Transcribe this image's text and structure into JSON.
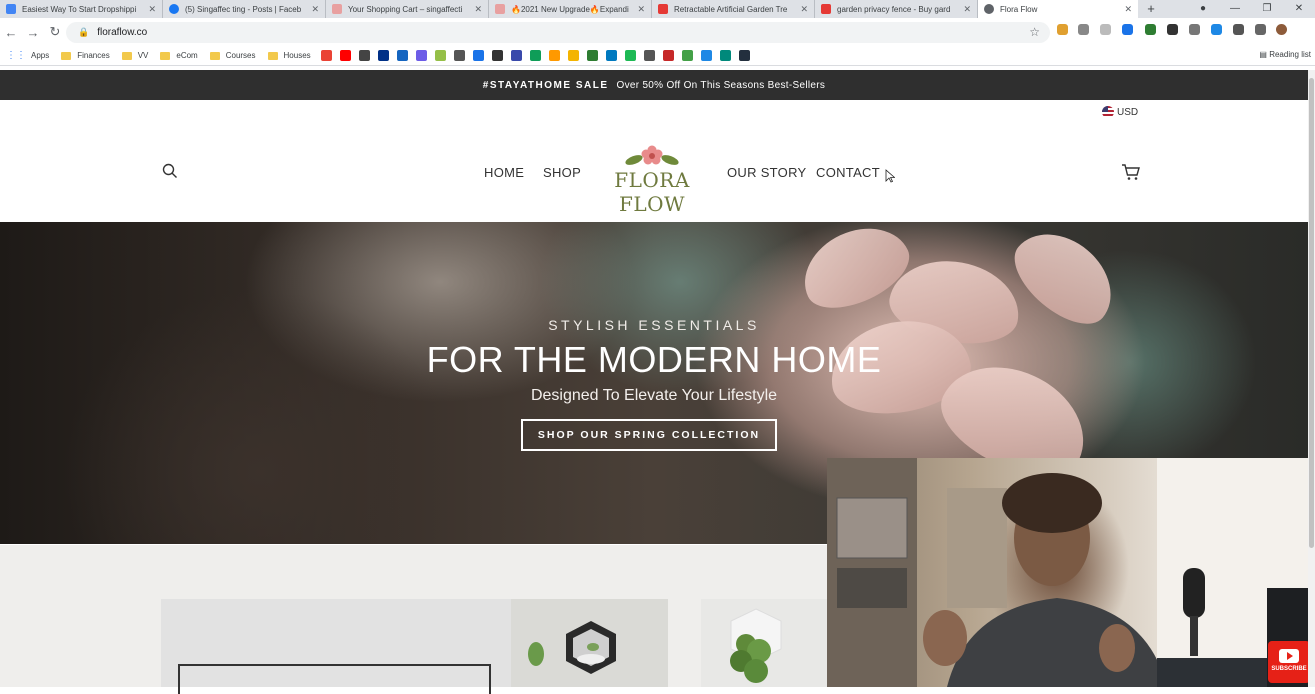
{
  "browser": {
    "tabs": [
      {
        "title": "Easiest Way To Start Dropshippi",
        "favicon_color": "#4285f4",
        "favicon": "docs-icon"
      },
      {
        "title": "(5) Singaffec ting - Posts | Faceb",
        "favicon_color": "#1877f2",
        "favicon": "facebook-icon"
      },
      {
        "title": "Your Shopping Cart – singaffecti",
        "favicon_color": "#e8a0a0",
        "favicon": "flower-icon"
      },
      {
        "title": "🔥2021 New Upgrade🔥Expandi",
        "favicon_color": "#e8a0a0",
        "favicon": "flower-icon"
      },
      {
        "title": "Retractable Artificial Garden Tre",
        "favicon_color": "#e53935",
        "favicon": "store-icon"
      },
      {
        "title": "garden privacy fence - Buy gard",
        "favicon_color": "#e53935",
        "favicon": "store-icon"
      },
      {
        "title": "Flora Flow",
        "favicon_color": "#5f6368",
        "favicon": "globe-icon",
        "active": true
      }
    ],
    "url": "floraflow.co",
    "bookmarks": {
      "apps_label": "Apps",
      "folders": [
        "Finances",
        "VV",
        "eCom",
        "Courses",
        "Houses"
      ],
      "reading_list": "Reading list"
    }
  },
  "site": {
    "promo": {
      "tag": "#STAYATHOME SALE",
      "text": "Over 50% Off On This Seasons Best-Sellers"
    },
    "currency": "USD",
    "nav": {
      "home": "HOME",
      "shop": "SHOP",
      "story": "OUR STORY",
      "contact": "CONTACT"
    },
    "logo_text": "FLORA FLOW",
    "hero": {
      "subtitle": "STYLISH ESSENTIALS",
      "title": "FOR THE MODERN HOME",
      "tagline": "Designed To Elevate Your Lifestyle",
      "cta": "SHOP OUR SPRING COLLECTION"
    }
  },
  "overlay": {
    "subscribe": "SUBSCRIBE"
  },
  "colors": {
    "promo_bg": "#2f2f2f",
    "logo_green": "#6f7a3f",
    "subscribe_red": "#e62117"
  }
}
